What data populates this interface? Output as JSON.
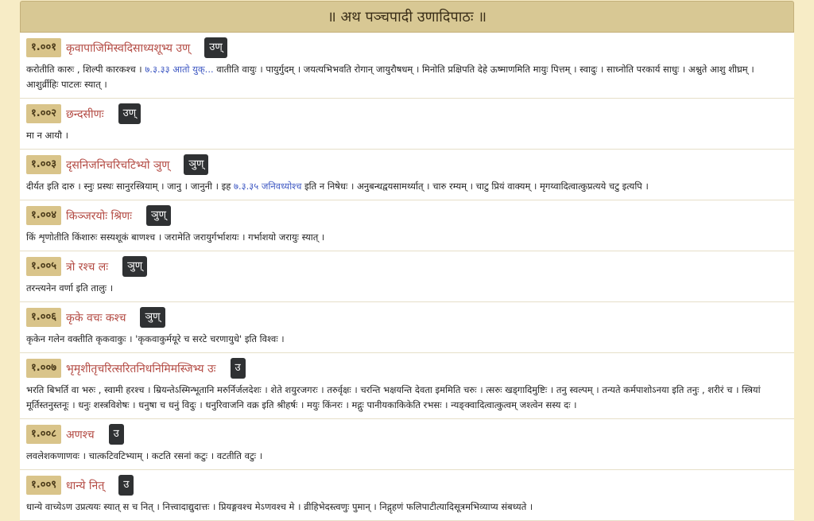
{
  "header": {
    "title": "॥ अथ पञ्चपादी उणादिपाठः ॥"
  },
  "entries": [
    {
      "num": "१.००१",
      "sutra": "कृवापाजिमिस्वदिसाध्यशूभ्य उण्",
      "tag": "उण्",
      "text_before": "करोतीति कारुः , शिल्पी कारकश्च । ",
      "link": "७.३.३३ आतो युक्...",
      "text_after": " वातीति वायुः । पायुर्गुदम् । जयत्यभिभवति रोगान् जायुरौषधम् । मिनोति प्रक्षिपति देहे ऊष्माणमिति मायुः पित्तम् । स्वादुः । साध्नोति परकार्य साधुः । अश्नुते आशु शीघ्रम् । आशुर्व्रीहिः पाटलः स्यात् ।"
    },
    {
      "num": "१.००२",
      "sutra": "छन्दसीणः",
      "tag": "उण्",
      "text": "मा न आयौ ।"
    },
    {
      "num": "१.००३",
      "sutra": "दृसनिजनिचरिचटिभ्यो ञुण्",
      "tag": "ञुण्",
      "text_before": "दीर्यत इति दारु । स्नुः प्रस्थः सानुरस्त्रियाम् । जानु । जानुनी । इह ",
      "link": "७.३.३५ जनिवध्योश्च",
      "text_after": " इति न निषेधः । अनुबन्धद्वयसामर्थ्यात् । चारु रम्यम् । चाटु प्रियं वाक्यम् । मृगय्वादित्वात्कुप्रत्यये चटु इत्यपि ।"
    },
    {
      "num": "१.००४",
      "sutra": "किञ्जरयोः श्रिणः",
      "tag": "ञुण्",
      "text": "किं शृणोतीति किंशारुः सस्यशूकं बाणश्च । जरामेति जरायुर्गर्भाशयः । गर्भाशयो जरायुः स्यात् ।"
    },
    {
      "num": "१.००५",
      "sutra": "त्रो रश्च लः",
      "tag": "ञुण्",
      "text": "तरन्त्यनेन वर्णा इति तालुः ।"
    },
    {
      "num": "१.००६",
      "sutra": "कृके वचः कश्च",
      "tag": "ञुण्",
      "text": "कृकेन गलेन वक्तीति कृकवाकुः । 'कृकवाकुर्मयूरे च सरटे चरणायुधे' इति विश्वः ।"
    },
    {
      "num": "१.००७",
      "sutra": "भृमृशीतृचरित्सरितनिधनिमिमस्जिभ्य उः",
      "tag": "उ",
      "text": "भरति बिभर्ति वा भरुः , स्वामी हरश्च । म्रियन्तेऽस्मिन्भूतानि मरुर्निर्जलदेशः । शेते शयुरजगरः । तरुर्वृक्षः । चरन्ति भक्षयन्ति देवता इममिति चरुः । त्सरुः खड्गादिमुष्टिः । तनु स्वल्पम् । तन्यते कर्मपाशोऽनया इति तनुः , शरीरं च । स्त्रियां मूर्तिस्तनुस्तनूः । धनुः शस्त्रविशेषः । धनुषा च धनुं विदुः । धनुरिवाजनि वक्र इति श्रीहर्षः । मयुः किंनरः । मद्गुः पानीयकाकिकेति रभसः । न्यङ्क्वादित्वात्कुत्वम् जश्त्वेन सस्य दः ।"
    },
    {
      "num": "१.००८",
      "sutra": "अणश्च",
      "tag": "उ",
      "text": "लवलेशकणाणवः । चात्कटिवटिभ्याम् । कटति रसनां कटुः । वटतीति वटुः ।"
    },
    {
      "num": "१.००९",
      "sutra": "धान्ये नित्",
      "tag": "उ",
      "text": "धान्ये वाच्येऽण उप्रत्ययः स्यात् स च नित् । नित्त्वादाद्युदात्तः । प्रियङ्गवश्च मेऽणवश्च मे । व्रीहिभेदस्त्वणुः पुमान् । निद्गृहणं फलिपाटीत्यादिसूत्रमभिव्याप्य संबध्यते ।"
    }
  ]
}
